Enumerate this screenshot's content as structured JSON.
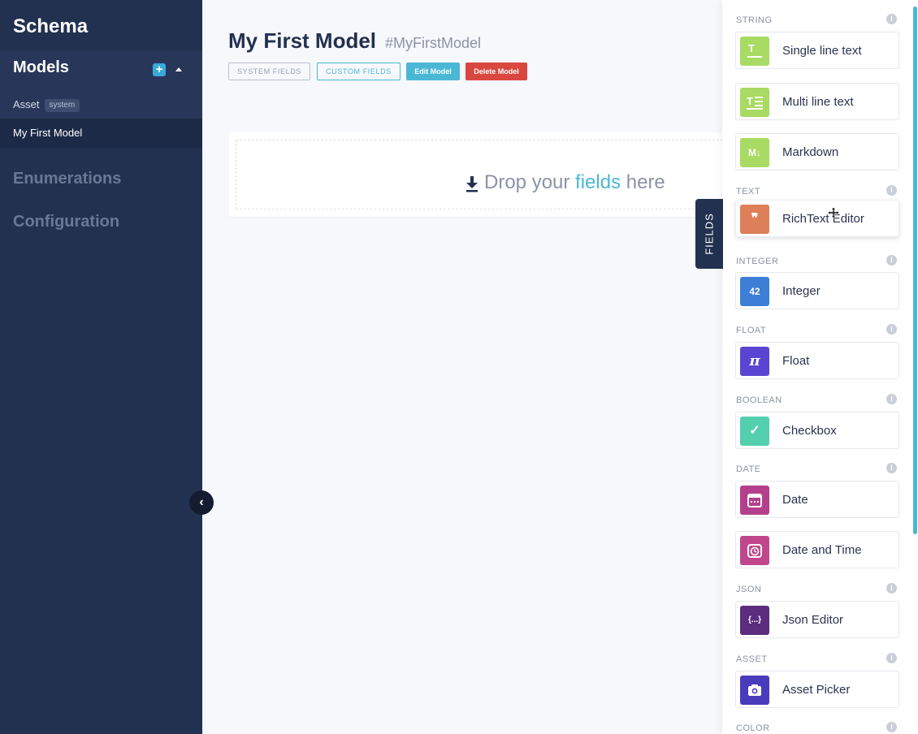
{
  "sidebar": {
    "title": "Schema",
    "models_heading": "Models",
    "add_icon": "+",
    "items": [
      {
        "label": "Asset",
        "badge": "system"
      },
      {
        "label": "My First Model"
      }
    ],
    "enumerations": "Enumerations",
    "configuration": "Configuration",
    "collapse_icon": "‹"
  },
  "header": {
    "title": "My First Model",
    "api_id": "#MyFirstModel",
    "buttons": {
      "system_fields": "SYSTEM FIELDS",
      "custom_fields": "CUSTOM FIELDS",
      "edit_model": "Edit Model",
      "delete_model": "Delete Model"
    }
  },
  "dropzone": {
    "prefix": "Drop your ",
    "accent": "fields",
    "suffix": " here"
  },
  "fields_tab": "FIELDS",
  "panel": {
    "info_glyph": "i",
    "categories": {
      "string": "STRING",
      "text": "TEXT",
      "integer": "INTEGER",
      "float": "FLOAT",
      "boolean": "BOOLEAN",
      "date": "DATE",
      "json": "JSON",
      "asset": "ASSET",
      "color": "COLOR"
    },
    "fields": {
      "single_line": {
        "label": "Single line text",
        "icon": "single-line-text-icon",
        "color": "#a9da63"
      },
      "multi_line": {
        "label": "Multi line text",
        "icon": "multi-line-text-icon",
        "color": "#a9da63"
      },
      "markdown": {
        "label": "Markdown",
        "icon": "markdown-icon",
        "glyph": "M↓",
        "color": "#a9da63"
      },
      "richtext": {
        "label": "RichText Editor",
        "icon": "quote-icon",
        "glyph": "❞",
        "color": "#dd7f58"
      },
      "integer": {
        "label": "Integer",
        "icon": "integer-icon",
        "glyph": "42",
        "color": "#3d7ed6"
      },
      "float": {
        "label": "Float",
        "icon": "pi-icon",
        "glyph": "π",
        "color": "#5a45d3"
      },
      "checkbox": {
        "label": "Checkbox",
        "icon": "checkmark-icon",
        "glyph": "✓",
        "color": "#54cfae"
      },
      "date": {
        "label": "Date",
        "icon": "calendar-icon",
        "color": "#b43f8c"
      },
      "datetime": {
        "label": "Date and Time",
        "icon": "alarm-clock-icon",
        "color": "#c0478c"
      },
      "json": {
        "label": "Json Editor",
        "icon": "braces-icon",
        "glyph": "{...}",
        "color": "#5c2c7e"
      },
      "asset": {
        "label": "Asset Picker",
        "icon": "camera-icon",
        "color": "#4a3bbd"
      }
    }
  }
}
